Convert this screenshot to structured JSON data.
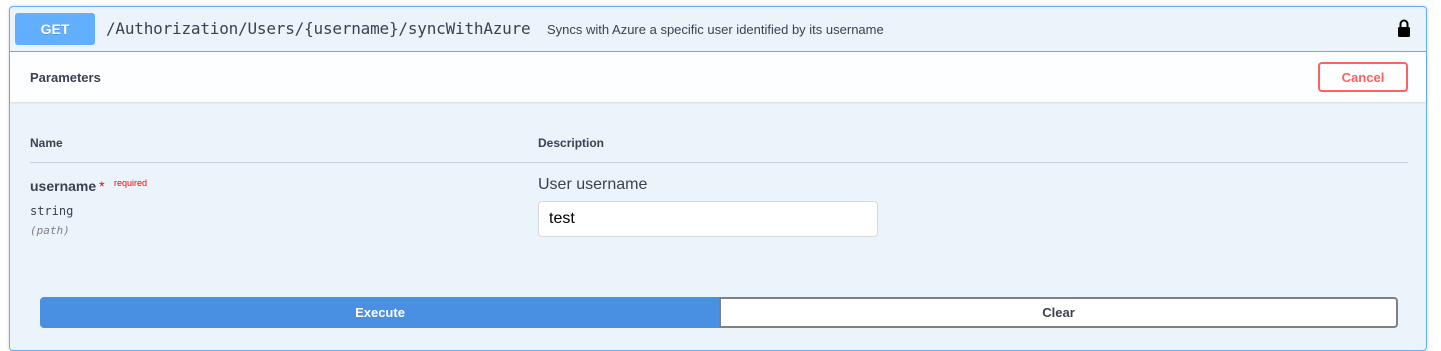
{
  "operation": {
    "method": "GET",
    "path": "/Authorization/Users/{username}/syncWithAzure",
    "summary": "Syncs with Azure a specific user identified by its username",
    "method_color": "#61affe"
  },
  "parameters": {
    "title": "Parameters",
    "cancel_label": "Cancel",
    "columns": {
      "name": "Name",
      "description": "Description"
    },
    "items": [
      {
        "name": "username",
        "required_marker": "*",
        "required_label": "required",
        "type": "string",
        "in": "(path)",
        "description": "User username",
        "value": "test"
      }
    ]
  },
  "actions": {
    "execute_label": "Execute",
    "clear_label": "Clear",
    "execute_color": "#4990e2"
  },
  "icons": {
    "auth": "lock-icon"
  }
}
